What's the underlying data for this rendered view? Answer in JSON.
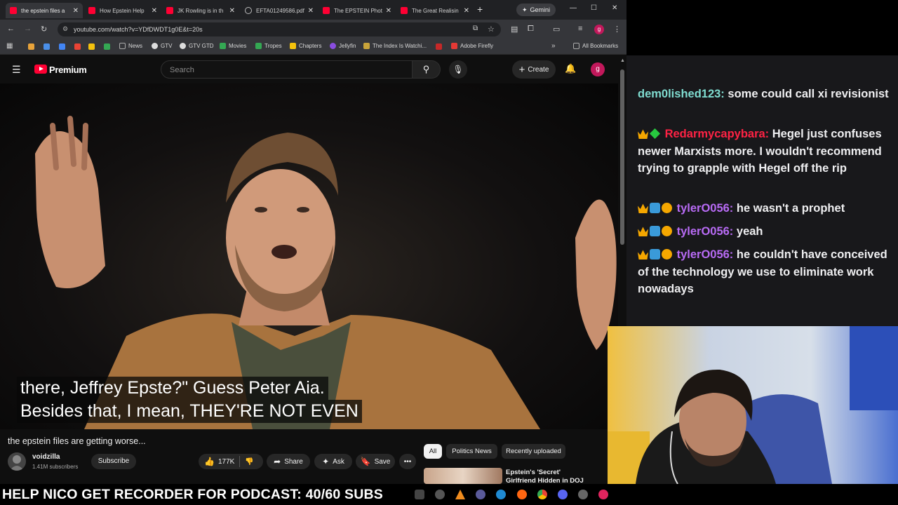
{
  "browser": {
    "tabs": [
      {
        "label": "the epstein files a",
        "active": true,
        "icon": "youtube-icon"
      },
      {
        "label": "How Epstein Help",
        "active": false,
        "icon": "youtube-icon"
      },
      {
        "label": "JK Rowling is in th",
        "active": false,
        "icon": "youtube-icon"
      },
      {
        "label": "EFTA01249586.pdf",
        "active": false,
        "icon": "globe-icon"
      },
      {
        "label": "The EPSTEIN Phot",
        "active": false,
        "icon": "youtube-icon"
      },
      {
        "label": "The Great Realisin",
        "active": false,
        "icon": "youtube-icon"
      }
    ],
    "gemini_label": "Gemini",
    "url": "youtube.com/watch?v=YDfDWDT1g0E&t=20s",
    "bookmarks": [
      "News",
      "GTV",
      "GTV GTD",
      "Movies",
      "Tropes",
      "Chapters",
      "Jellyfin",
      "The Index Is Watchi...",
      "Adobe Firefly"
    ],
    "all_bookmarks_label": "All Bookmarks",
    "profile_initial": "g"
  },
  "youtube": {
    "logo_text": "Premium",
    "search_placeholder": "Search",
    "create_label": "Create",
    "avatar_initial": "g",
    "video": {
      "caption_lines": [
        "there, Jeffrey Epste?\" Guess Peter Aia.",
        "Besides that, I mean, THEY'RE NOT EVEN"
      ],
      "title": "the epstein files are getting worse...",
      "channel": "voidzilla",
      "subscribers": "1.41M subscribers",
      "subscribe_label": "Subscribe",
      "likes": "177K",
      "share_label": "Share",
      "ask_label": "Ask",
      "save_label": "Save"
    },
    "chips": [
      "All",
      "Politics News",
      "Recently uploaded"
    ],
    "recommendation_title": "Epstein's 'Secret' Girlfriend Hidden in DOJ Files"
  },
  "chat": {
    "messages": [
      {
        "user": "dem0lished123:",
        "text": "some could call xi revisionist",
        "color": "#7fdcd0",
        "badges": []
      },
      {
        "user": "Redarmycapybara:",
        "text": "Hegel just confuses newer Marxists more. I wouldn't recommend trying to grapple with Hegel off the rip",
        "color": "#ff2244",
        "badges": [
          "crown",
          "diamond"
        ]
      },
      {
        "user": "tylerO056:",
        "text": "he wasn't a prophet",
        "color": "#b86bf5",
        "badges": [
          "crown",
          "sub",
          "coin"
        ]
      },
      {
        "user": "tylerO056:",
        "text": "yeah",
        "color": "#b86bf5",
        "badges": [
          "crown",
          "sub",
          "coin"
        ]
      },
      {
        "user": "tylerO056:",
        "text": "he couldn't have conceived of the technology we use to eliminate work nowadays",
        "color": "#b86bf5",
        "badges": [
          "crown",
          "sub",
          "coin"
        ]
      }
    ]
  },
  "ticker": {
    "text": "HELP NICO GET RECORDER FOR PODCAST: 40/60 SUBS"
  }
}
